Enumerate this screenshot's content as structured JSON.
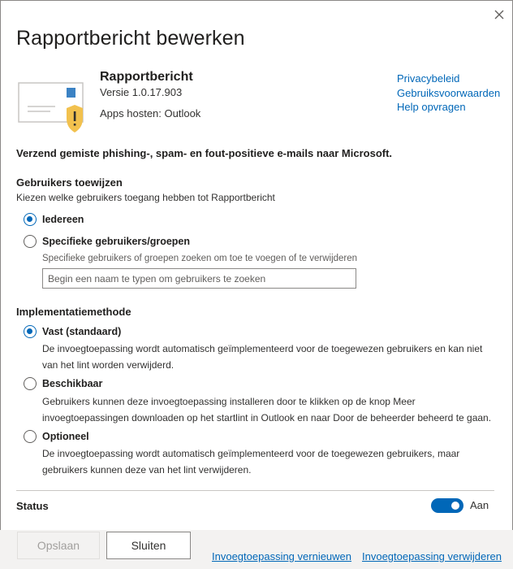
{
  "dialog": {
    "title": "Rapportbericht bewerken",
    "close_icon": "close-icon"
  },
  "app": {
    "icon": "mail-warning-icon",
    "name": "Rapportbericht",
    "version": "Versie 1.0.17.903",
    "hosts": "Apps hosten: Outlook",
    "links": [
      "Privacybeleid",
      "Gebruiksvoorwaarden",
      "Help opvragen"
    ],
    "description": "Verzend gemiste phishing-, spam- en fout-positieve e-mails naar Microsoft."
  },
  "assign": {
    "title": "Gebruikers toewijzen",
    "subtitle": "Kiezen welke gebruikers toegang hebben tot Rapportbericht",
    "options": [
      {
        "label": "Iedereen",
        "checked": true
      },
      {
        "label": "Specifieke gebruikers/groepen",
        "checked": false
      }
    ],
    "search_label": "Specifieke gebruikers of groepen zoeken om toe te voegen of te verwijderen",
    "search_placeholder": "Begin een naam te typen om gebruikers te zoeken",
    "search_value": ""
  },
  "deploy": {
    "title": "Implementatiemethode",
    "options": [
      {
        "label": "Vast (standaard)",
        "checked": true,
        "description": "De invoegtoepassing wordt automatisch geïmplementeerd voor de toegewezen gebruikers en kan niet van het lint worden verwijderd."
      },
      {
        "label": "Beschikbaar",
        "checked": false,
        "description": "Gebruikers kunnen deze invoegtoepassing installeren door te klikken op de knop Meer invoegtoepassingen downloaden op het startlint in Outlook en naar Door de beheerder beheerd te gaan."
      },
      {
        "label": "Optioneel",
        "checked": false,
        "description": "De invoegtoepassing wordt automatisch geïmplementeerd voor de toegewezen gebruikers, maar gebruikers kunnen deze van het lint verwijderen."
      }
    ]
  },
  "status": {
    "label": "Status",
    "toggle_on": true,
    "toggle_text": "Aan"
  },
  "footer": {
    "save_label": "Opslaan",
    "close_label": "Sluiten",
    "update_link": "Invoegtoepassing vernieuwen",
    "remove_link": "Invoegtoepassing verwijderen"
  },
  "colors": {
    "accent": "#0067b8",
    "warning_shield": "#f2c14e"
  }
}
